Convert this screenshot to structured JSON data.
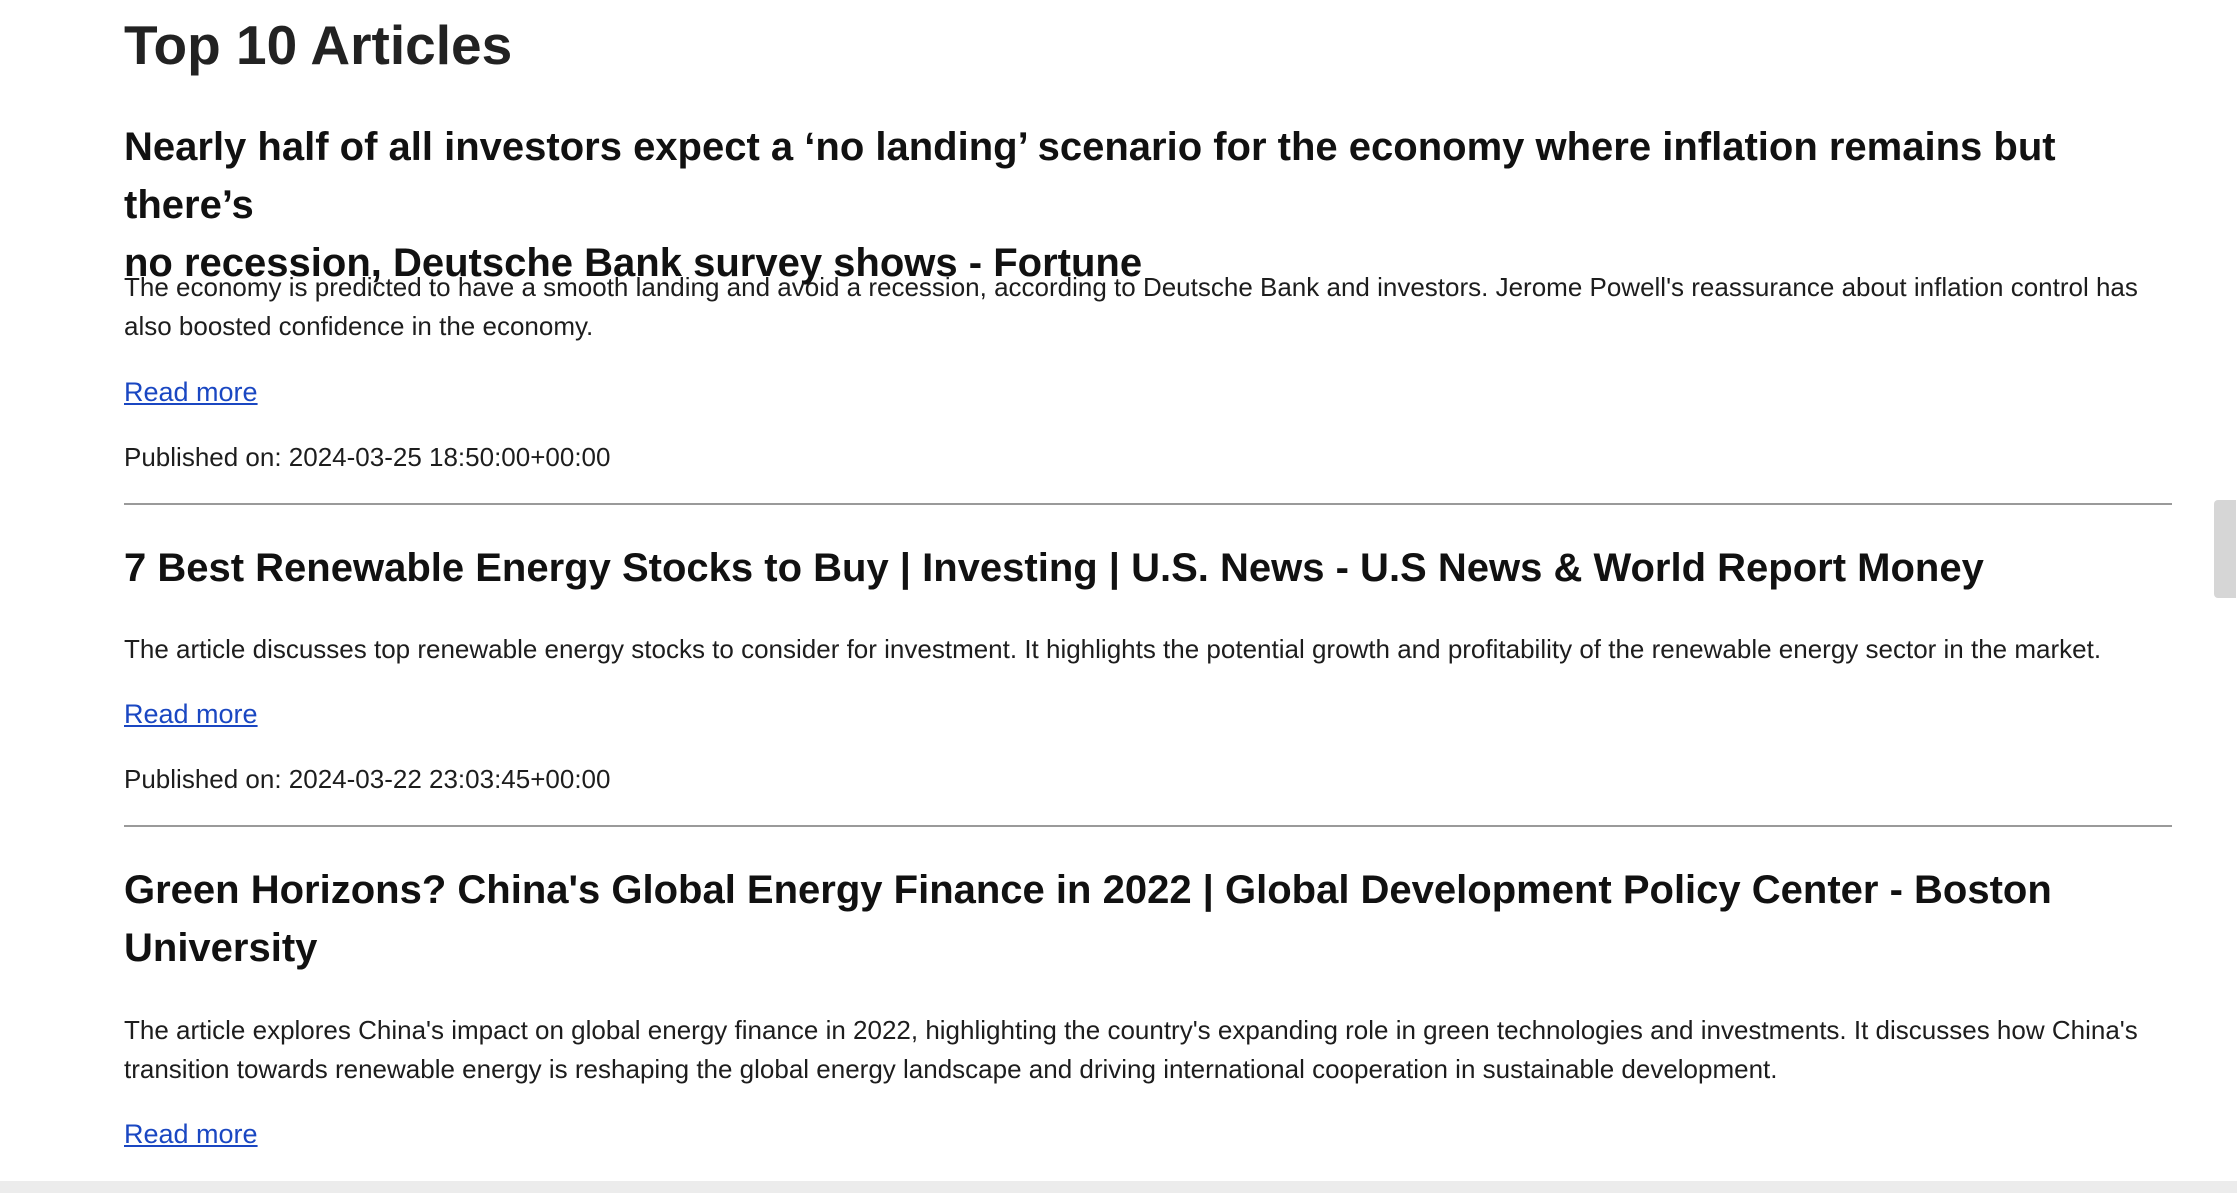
{
  "page": {
    "title": "Top 10 Articles"
  },
  "articles": [
    {
      "title_line1": "Nearly half of all investors expect a ‘no landing’ scenario for the economy where inflation remains but there’s",
      "title_line2": "no recession, Deutsche Bank survey shows - Fortune",
      "summary_line1": "The economy is predicted to have a smooth landing and avoid a recession, according to Deutsche Bank and investors. Jerome Powell's reassurance about inflation control has",
      "summary_line2": "also boosted confidence in the economy.",
      "read_more": "Read more",
      "published": "Published on: 2024-03-25 18:50:00+00:00"
    },
    {
      "title_line1": "7 Best Renewable Energy Stocks to Buy | Investing | U.S. News - U.S News & World Report Money",
      "summary_line1": "The article discusses top renewable energy stocks to consider for investment. It highlights the potential growth and profitability of the renewable energy sector in the market.",
      "read_more": "Read more",
      "published": "Published on: 2024-03-22 23:03:45+00:00"
    },
    {
      "title_line1": "Green Horizons? China's Global Energy Finance in 2022 | Global Development Policy Center - Boston",
      "title_line2": "University",
      "summary_line1": "The article explores China's impact on global energy finance in 2022, highlighting the country's expanding role in green technologies and investments. It discusses how China's",
      "summary_line2": "transition towards renewable energy is reshaping the global energy landscape and driving international cooperation in sustainable development.",
      "read_more": "Read more"
    }
  ],
  "colors": {
    "link": "#1a47c2",
    "divider": "#9a9a9a",
    "text": "#1d1d1d"
  }
}
